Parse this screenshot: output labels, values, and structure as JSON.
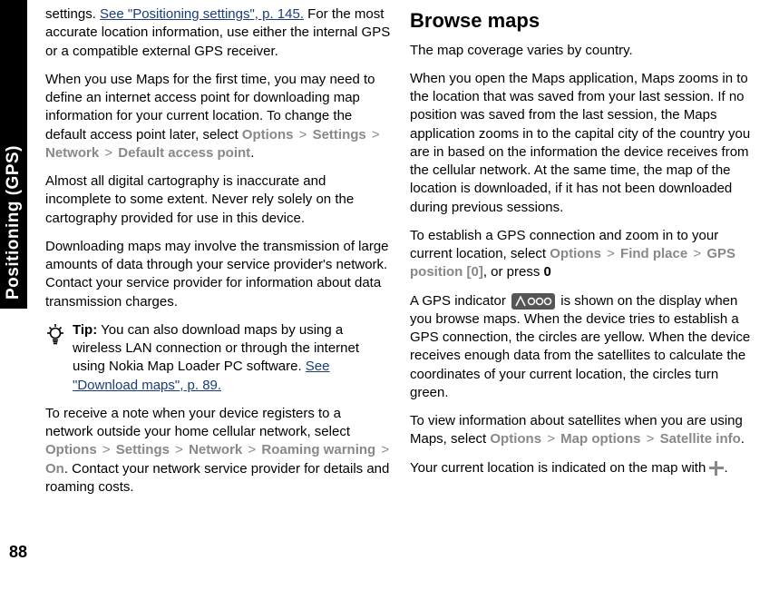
{
  "sideTab": "Positioning (GPS)",
  "pageNumber": "88",
  "left": {
    "p1a": "settings. ",
    "p1link": "See \"Positioning settings\", p. 145.",
    "p1b": " For the most accurate location information, use either the internal GPS or a compatible external GPS receiver.",
    "p2a": "When you use Maps for the first time, you may need to define an internet access point for downloading map information for your current location. To change the default access point later, select ",
    "p2pathOptions": "Options",
    "p2pathSettings": "Settings",
    "p2pathNetwork": "Network",
    "p2pathDefault": "Default access point",
    "p2b": ".",
    "p3": "Almost all digital cartography is inaccurate and incomplete to some extent. Never rely solely on the cartography provided for use in this device.",
    "p4": "Downloading maps may involve the transmission of large amounts of data through your service provider's network. Contact your service provider for information about data transmission charges.",
    "tipLabel": "Tip:",
    "tipBody": " You can also download maps by using a wireless LAN connection or through the internet using Nokia Map Loader PC software. ",
    "tipLink": "See \"Download maps\", p. 89.",
    "p5a": "To receive a note when your device registers to a network outside your home cellular network, select ",
    "p5pathOptions": "Options",
    "p5pathSettings": "Settings",
    "p5pathNetwork": "Network",
    "p5pathRoaming": "Roaming warning",
    "p5pathOn": "On",
    "p5b": ". Contact your network service provider for details and roaming costs."
  },
  "right": {
    "heading": "Browse maps",
    "p1": "The map coverage varies by country.",
    "p2": "When you open the Maps application, Maps zooms in to the location that was saved from your last session. If no position was saved from the last session, the Maps application zooms in to the capital city of the country you are in based on the information the device receives from the cellular network. At the same time, the map of the location is downloaded, if it has not been downloaded during previous sessions.",
    "p3a": "To establish a GPS connection and zoom in to your current location, select ",
    "p3pathOptions": "Options",
    "p3pathFind": "Find place",
    "p3pathGPS": "GPS position [0]",
    "p3b": ", or press ",
    "p3zero": "0",
    "p4a": "A GPS indicator ",
    "p4b": " is shown on the display when you browse maps. When the device tries to establish a GPS connection, the circles are yellow. When the device receives enough data from the satellites to calculate the coordinates of your current location, the circles turn green.",
    "p5a": "To view information about satellites when you are using Maps, select ",
    "p5pathOptions": "Options",
    "p5pathMapOptions": "Map options",
    "p5pathSatellite": "Satellite info",
    "p5b": ".",
    "p6a": "Your current location is indicated on the map with ",
    "p6b": "."
  }
}
